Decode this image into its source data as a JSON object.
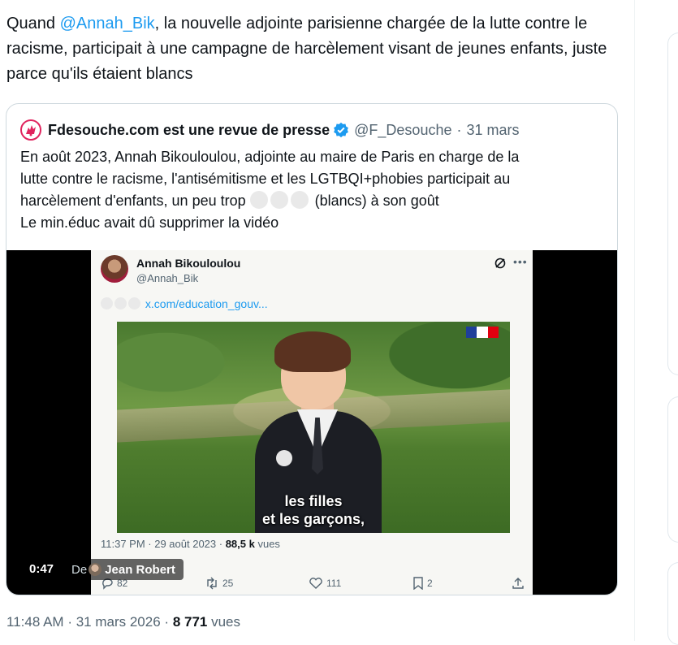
{
  "tweet": {
    "text_prefix": "Quand ",
    "mention": "@Annah_Bik",
    "text_suffix": ",  la nouvelle adjointe parisienne chargée de la lutte contre le racisme, participait à une campagne de harcèlement visant de jeunes enfants, juste parce qu'ils étaient blancs",
    "timestamp": "11:48 AM",
    "separator": "·",
    "date": "31 mars 2026",
    "views_count": "8 771",
    "views_label": "vues"
  },
  "quote": {
    "display_name": "Fdesouche.com est une revue de presse",
    "handle": "@F_Desouche",
    "separator": "·",
    "date": "31 mars",
    "line1": "En août 2023, Annah Bikouloulou, adjointe au maire de Paris en charge de la",
    "line2": "lutte contre le racisme, l'antisémitisme et les LGTBQI+phobies participait au",
    "line3_before": "harcèlement d'enfants, un peu trop",
    "line3_after": " (blancs) à son goût",
    "line4": "Le min.éduc avait dû supprimer la vidéo"
  },
  "video": {
    "duration": "0:47",
    "from_prefix": "De",
    "from_name": "Jean Robert",
    "inner": {
      "name": "Annah Bikouloulou",
      "handle": "@Annah_Bik",
      "link": "x.com/education_gouv...",
      "subtitle_line1": "les filles",
      "subtitle_line2": "et les garçons,",
      "meta_time": "11:37 PM · 29 août 2023 · ",
      "meta_views": "88,5 k",
      "meta_views_label": " vues",
      "replies": "82",
      "reposts": "25",
      "likes": "111",
      "bookmarks": "2"
    }
  },
  "colors": {
    "accent": "#1d9bf0",
    "verified": "#1d9bf0",
    "secondary_text": "#536471",
    "border": "#cfd9de"
  },
  "icons": [
    "rooster-logo-icon",
    "verified-badge-icon",
    "grok-icon",
    "more-icon",
    "reply-icon",
    "repost-icon",
    "like-icon",
    "bookmark-icon",
    "share-icon",
    "french-flag-icon"
  ]
}
